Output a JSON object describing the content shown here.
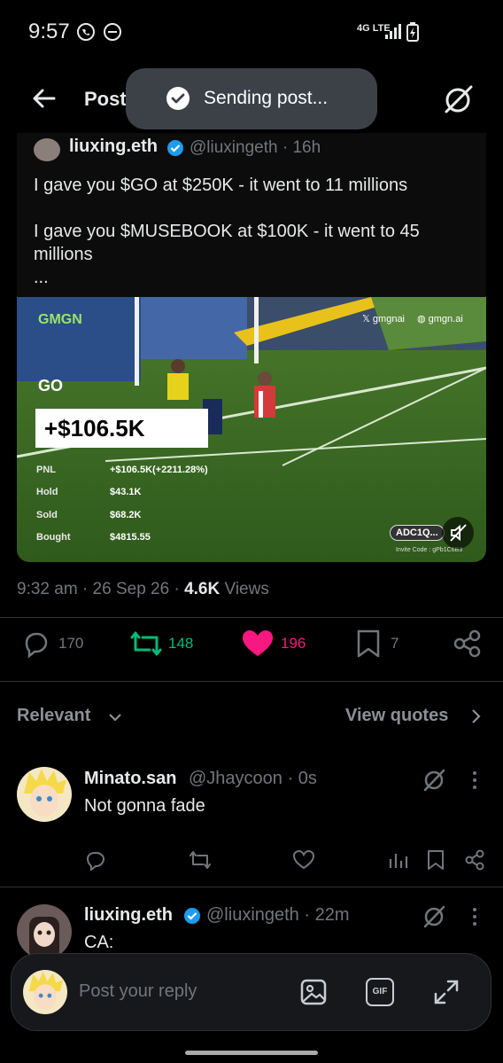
{
  "status_bar": {
    "time": "9:57",
    "network": "4G LTE"
  },
  "header": {
    "title": "Post"
  },
  "toast": {
    "text": "Sending post..."
  },
  "quoted_post": {
    "name": "liuxing.eth",
    "handle": "@liuxingeth · 16h",
    "lines": [
      "I gave you $GO at $250K - it went to 11 millions",
      "",
      "I gave you $MUSEBOOK at $100K - it went to 45",
      "millions",
      "..."
    ],
    "media": {
      "brand": "GMGN",
      "social_x": "gmgnai",
      "social_web": "gmgn.ai",
      "token": "GO",
      "pnl_big": "+$106.5K",
      "stats": [
        {
          "label": "PNL",
          "value": "+$106.5K(+2211.28%)"
        },
        {
          "label": "Hold",
          "value": "$43.1K"
        },
        {
          "label": "Sold",
          "value": "$68.2K"
        },
        {
          "label": "Bought",
          "value": "$4815.55"
        }
      ],
      "ca_badge": "ADC1Q...",
      "invite": "Invite Code : gPb1C6B3"
    }
  },
  "meta": {
    "time": "9:32 am",
    "date": "26 Sep 26",
    "views_count": "4.6K",
    "views_label": "Views"
  },
  "actions": {
    "replies": "170",
    "reposts": "148",
    "likes": "196",
    "bookmarks": "7"
  },
  "colors": {
    "repost": "#00ba7c",
    "like": "#f91880",
    "verified": "#1d9bf0"
  },
  "sort": {
    "label": "Relevant",
    "view_quotes": "View quotes"
  },
  "replies": [
    {
      "name": "Minato.san",
      "handle": "@Jhaycoon · 0s",
      "text": "Not gonna fade"
    },
    {
      "name": "liuxing.eth",
      "handle": "@liuxingeth · 22m",
      "text": "CA:"
    }
  ],
  "composer": {
    "placeholder": "Post your reply",
    "gif_label": "GIF"
  }
}
